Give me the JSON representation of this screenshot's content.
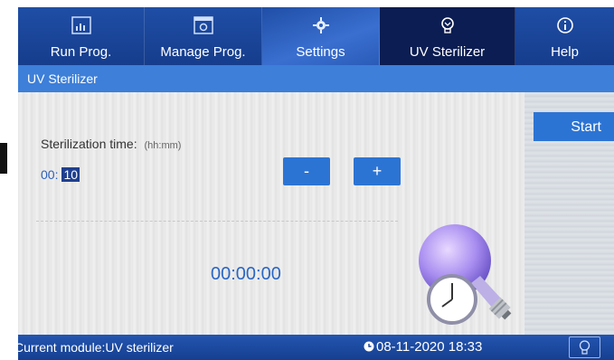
{
  "nav": {
    "tabs": [
      {
        "label": "Run Prog.",
        "icon": "run-program-icon"
      },
      {
        "label": "Manage Prog.",
        "icon": "manage-program-icon"
      },
      {
        "label": "Settings",
        "icon": "gear-icon"
      },
      {
        "label": "UV Sterilizer",
        "icon": "uv-bulb-icon"
      },
      {
        "label": "Help",
        "icon": "info-icon"
      }
    ],
    "active_tab": "UV Sterilizer"
  },
  "page": {
    "title": "UV Sterilizer"
  },
  "sterilization": {
    "label": "Sterilization time:",
    "unit_hint": "(hh:mm)",
    "hours": "00",
    "separator": ":",
    "minutes": "10",
    "decrement_label": "-",
    "increment_label": "+"
  },
  "timer": {
    "value": "00:00:00"
  },
  "actions": {
    "start_label": "Start"
  },
  "status_bar": {
    "module_text": "Current module:UV sterilizer",
    "datetime": "08-11-2020 18:33"
  },
  "colors": {
    "nav_bg": "#1f4ea6",
    "active_tab": "#0b1d52",
    "accent_button": "#2c74d4",
    "subheader": "#3d7fd9",
    "timer_text": "#2a66c4"
  }
}
